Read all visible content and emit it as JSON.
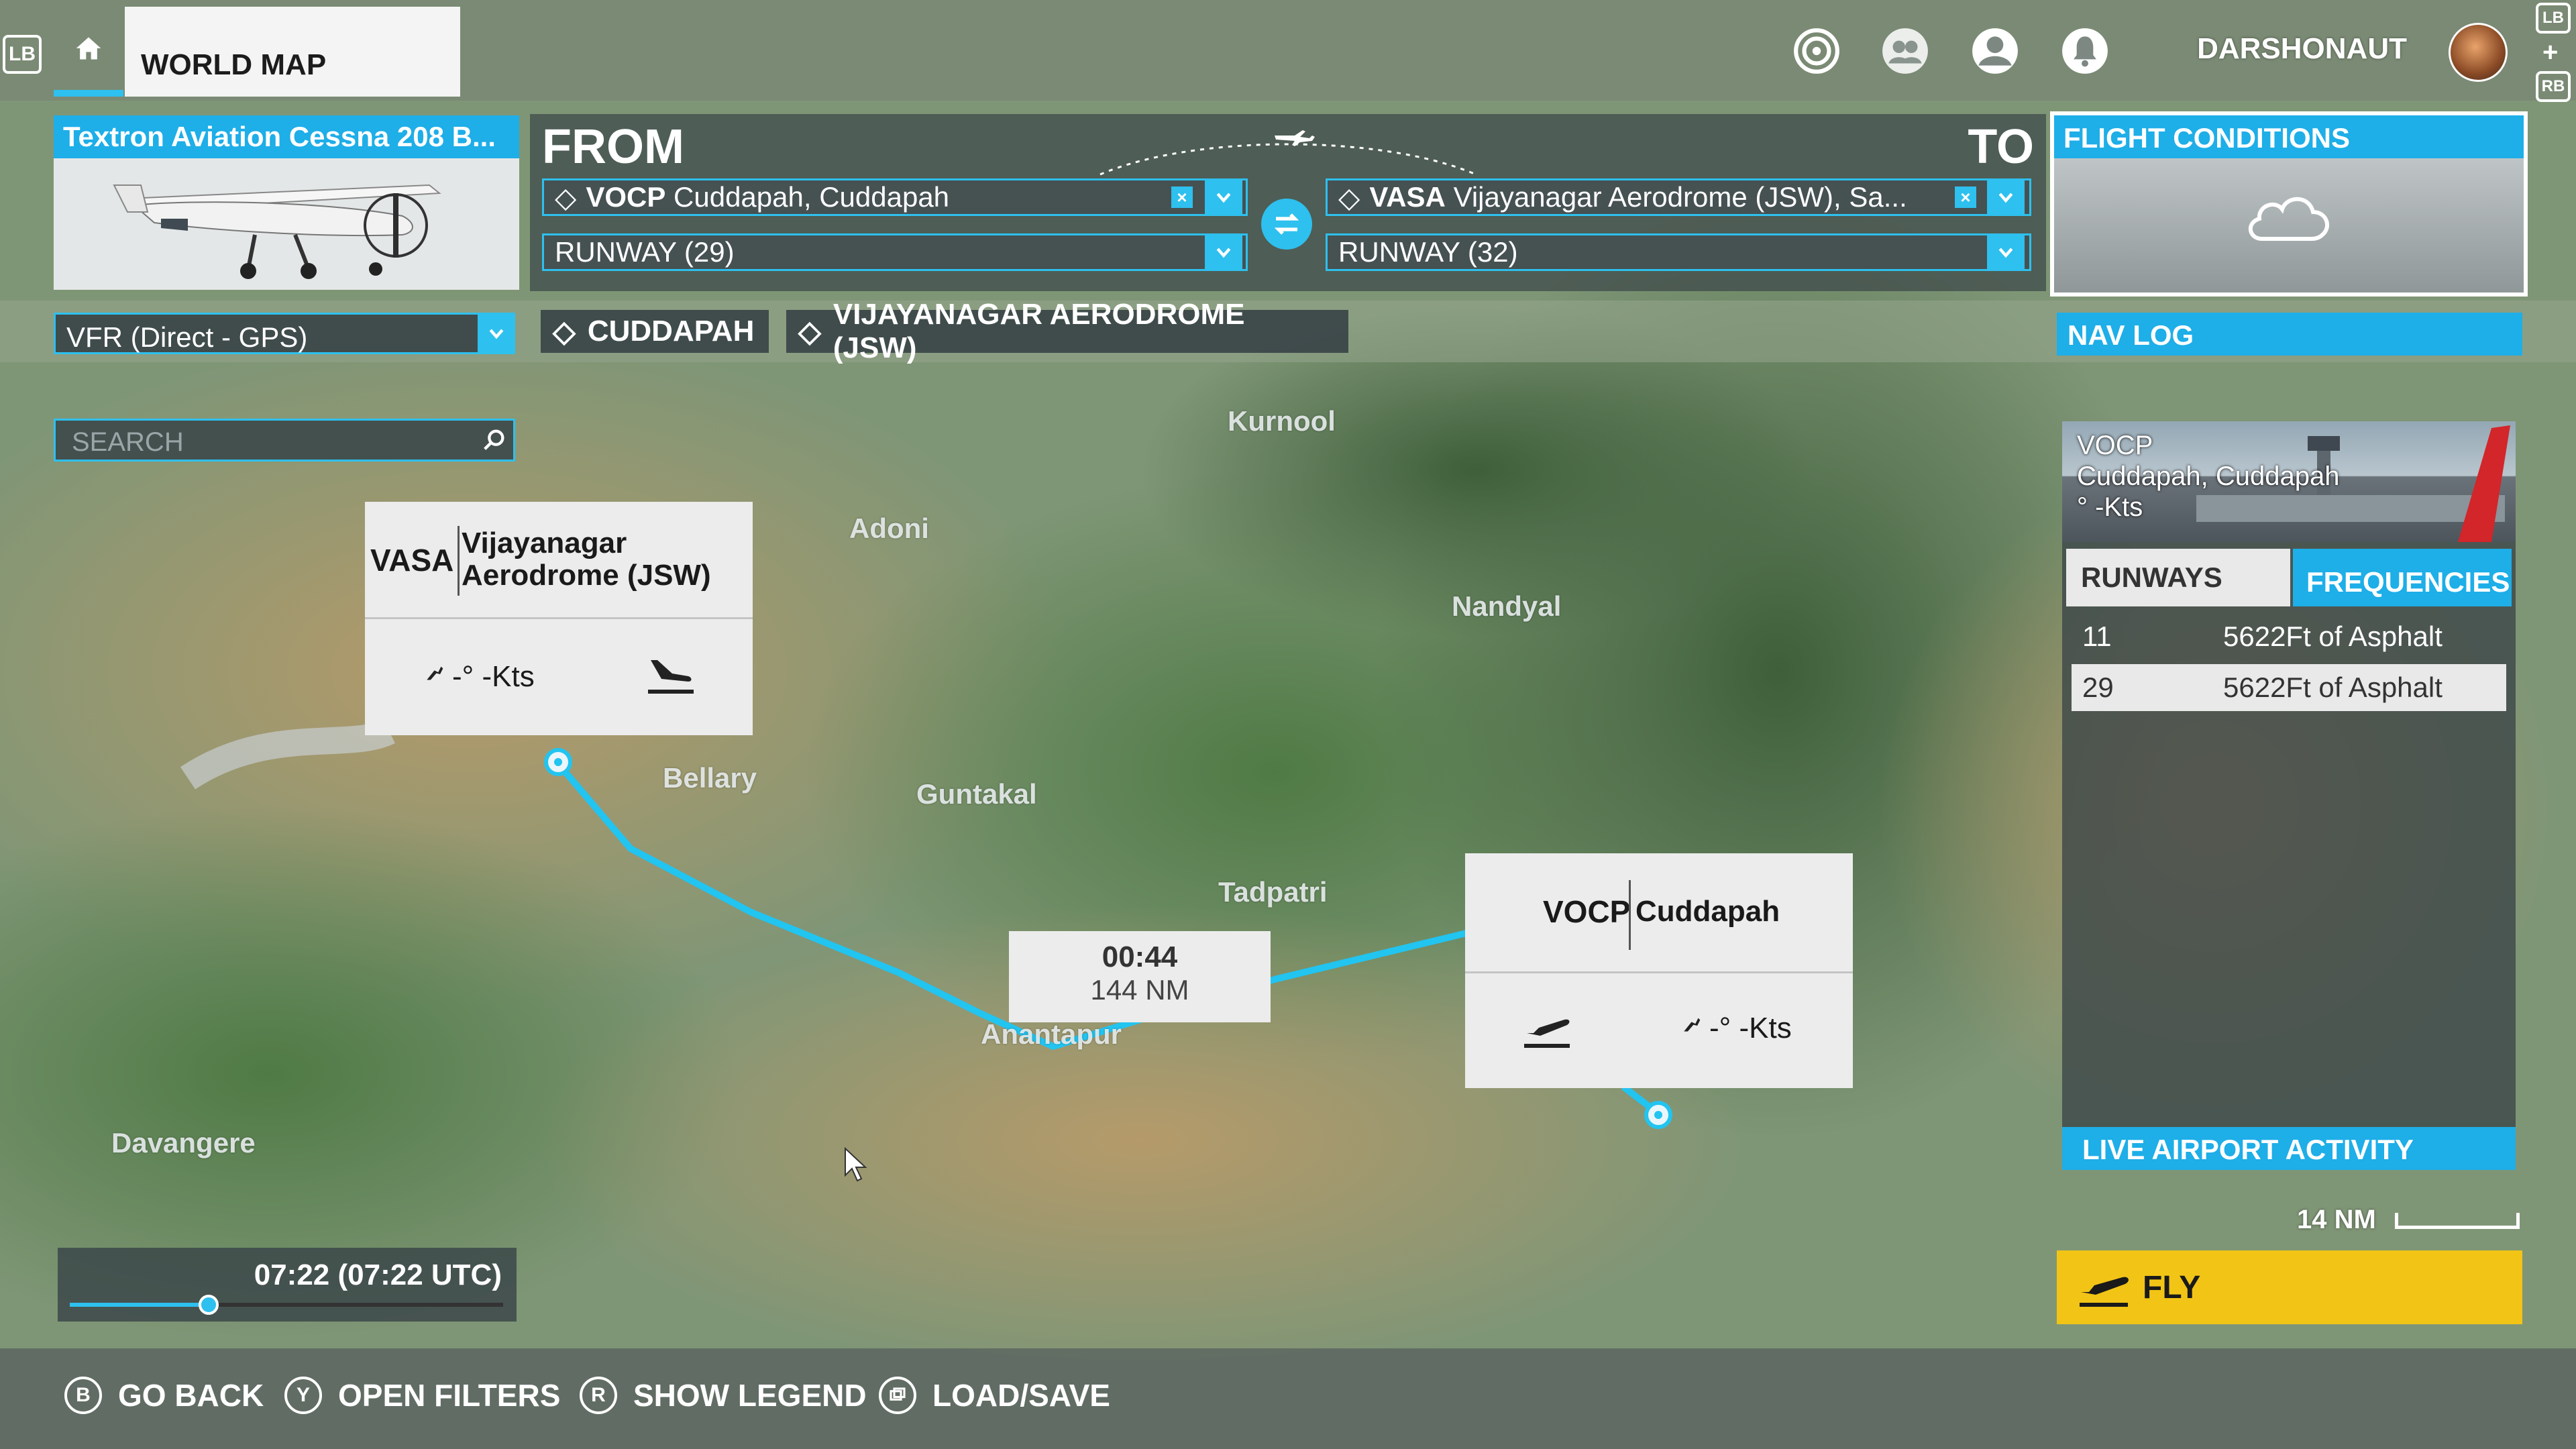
{
  "topbar": {
    "lb": "LB",
    "rb": "RB",
    "lb_small": "LB",
    "plus": "+",
    "tab_title": "WORLD MAP",
    "username": "DARSHONAUT"
  },
  "aircraft": {
    "title": "Textron Aviation Cessna 208 B..."
  },
  "route": {
    "from_label": "FROM",
    "to_label": "TO",
    "from_code": "VOCP",
    "from_name": "Cuddapah, Cuddapah",
    "from_runway": "RUNWAY (29)",
    "to_code": "VASA",
    "to_name": "Vijayanagar Aerodrome (JSW), Sa...",
    "to_runway": "RUNWAY (32)",
    "clear_symbol": "×"
  },
  "conditions": {
    "title": "FLIGHT CONDITIONS"
  },
  "row2": {
    "flight_type": "VFR (Direct - GPS)",
    "chip_from": "CUDDAPAH",
    "chip_to": "VIJAYANAGAR AERODROME (JSW)",
    "navlog": "NAV LOG"
  },
  "search": {
    "placeholder": "SEARCH"
  },
  "map_labels": {
    "kurnool": "Kurnool",
    "adoni": "Adoni",
    "nandyal": "Nandyal",
    "bellary": "Bellary",
    "guntakal": "Guntakal",
    "tadpatri": "Tadpatri",
    "anantapur": "Anantapur",
    "davangere": "Davangere"
  },
  "dest_popup": {
    "code": "VASA",
    "name_line1": "Vijayanagar",
    "name_line2": "Aerodrome (JSW)",
    "wind": "-° -Kts"
  },
  "origin_popup": {
    "code": "VOCP",
    "name": "Cuddapah",
    "wind": "-° -Kts"
  },
  "leg": {
    "time": "00:44",
    "distance": "144 NM"
  },
  "airport_panel": {
    "code": "VOCP",
    "name": "Cuddapah, Cuddapah",
    "wind": "° -Kts",
    "tab_runways": "RUNWAYS",
    "tab_frequencies": "FREQUENCIES",
    "runways": [
      {
        "id": "11",
        "desc": "5622Ft of Asphalt"
      },
      {
        "id": "29",
        "desc": "5622Ft of Asphalt"
      }
    ],
    "live": "LIVE AIRPORT ACTIVITY"
  },
  "scale": {
    "label": "14 NM"
  },
  "fly": {
    "label": "FLY"
  },
  "time": {
    "label": "07:22 (07:22 UTC)",
    "slider_fraction": 0.32
  },
  "bottombar": {
    "back_key": "B",
    "back": "GO BACK",
    "filters_key": "Y",
    "filters": "OPEN FILTERS",
    "legend_key": "R",
    "legend": "SHOW LEGEND",
    "load": "LOAD/SAVE"
  },
  "colors": {
    "accent": "#1eaee8",
    "route": "#22c4f0",
    "fly": "#f2c416"
  }
}
